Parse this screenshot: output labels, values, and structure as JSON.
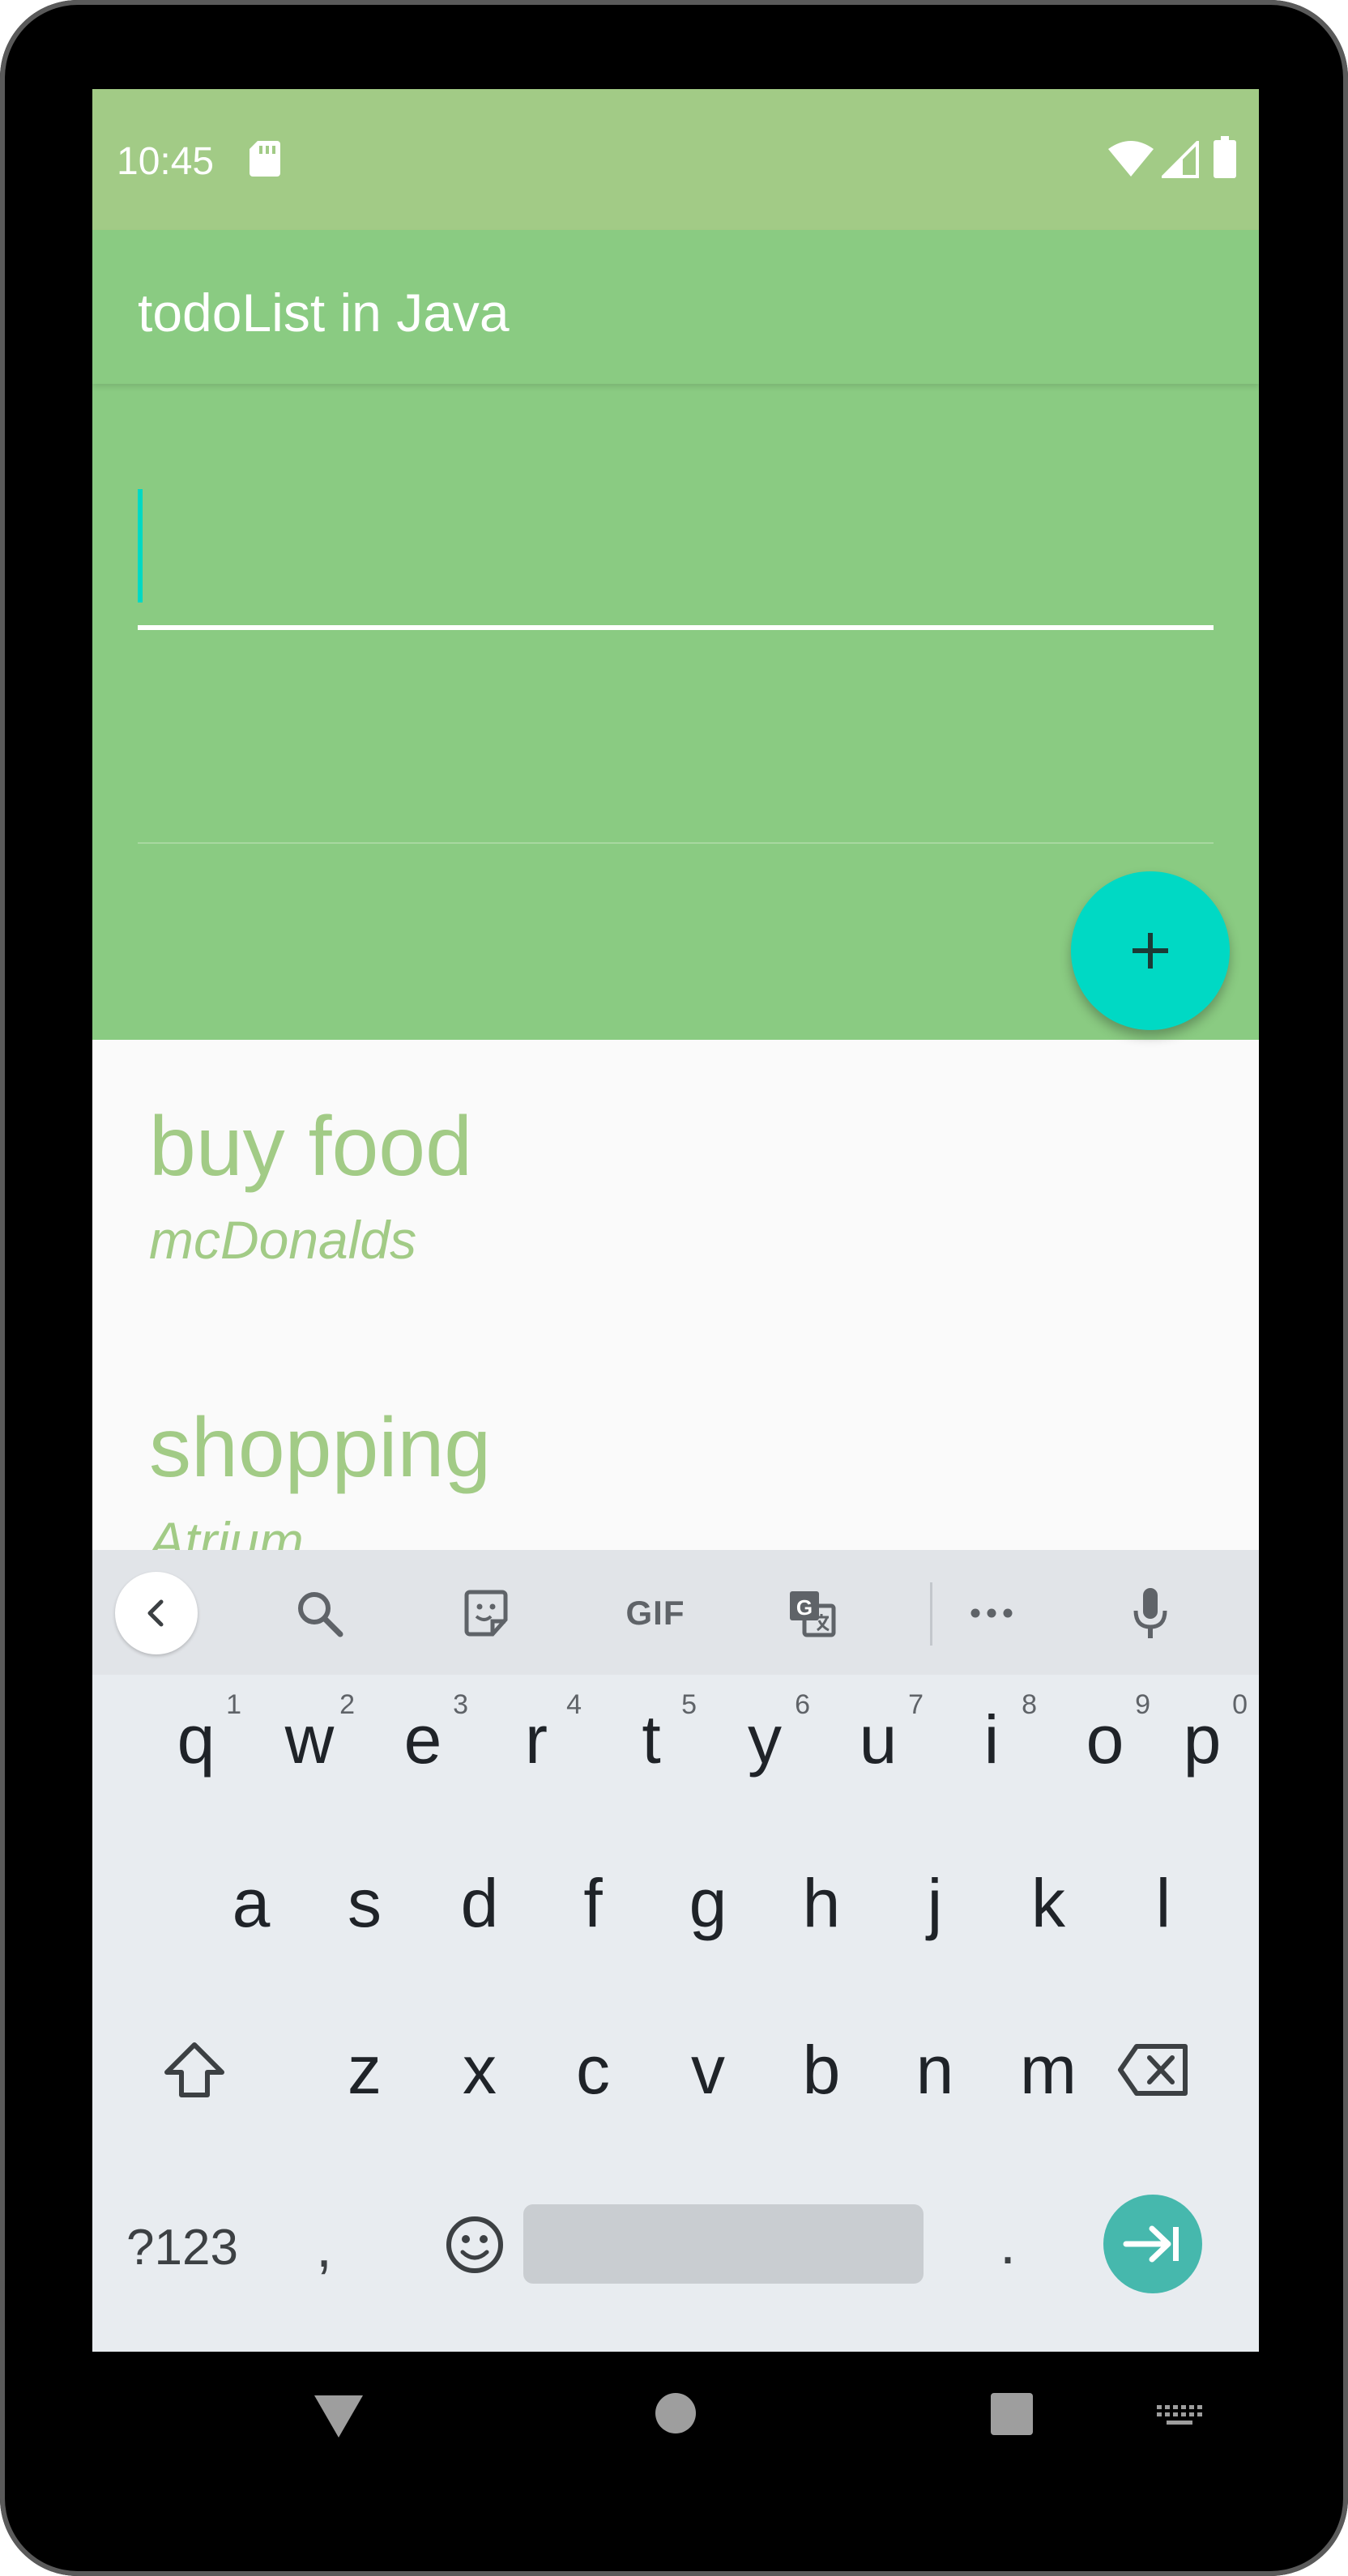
{
  "status_bar": {
    "time": "10:45"
  },
  "app_bar": {
    "title": "todoList in Java"
  },
  "input": {
    "value": "",
    "placeholder": ""
  },
  "todos": [
    {
      "title": "buy food",
      "subtitle": "mcDonalds"
    },
    {
      "title": "shopping",
      "subtitle": "Atrium"
    }
  ],
  "keyboard": {
    "toolbar": {
      "gif_label": "GIF"
    },
    "row1": [
      {
        "letter": "q",
        "hint": "1"
      },
      {
        "letter": "w",
        "hint": "2"
      },
      {
        "letter": "e",
        "hint": "3"
      },
      {
        "letter": "r",
        "hint": "4"
      },
      {
        "letter": "t",
        "hint": "5"
      },
      {
        "letter": "y",
        "hint": "6"
      },
      {
        "letter": "u",
        "hint": "7"
      },
      {
        "letter": "i",
        "hint": "8"
      },
      {
        "letter": "o",
        "hint": "9"
      },
      {
        "letter": "p",
        "hint": "0"
      }
    ],
    "row2": [
      "a",
      "s",
      "d",
      "f",
      "g",
      "h",
      "j",
      "k",
      "l"
    ],
    "row3": [
      "z",
      "x",
      "c",
      "v",
      "b",
      "n",
      "m"
    ],
    "bottom": {
      "symbols_label": "?123",
      "comma": ",",
      "period": "."
    }
  },
  "colors": {
    "status_bar": "#a2cb86",
    "app_bar": "#8acb82",
    "accent": "#00d9c4",
    "list_text": "#a2cb86",
    "enter_key": "#46b8ad"
  },
  "icons": {
    "status": [
      "sd-card-icon",
      "wifi-icon",
      "signal-icon",
      "battery-icon"
    ],
    "keyboard_toolbar": [
      "chevron-left-icon",
      "search-icon",
      "sticker-icon",
      "gif-icon",
      "translate-icon",
      "more-icon",
      "mic-icon"
    ],
    "navigation": [
      "back-triangle-icon",
      "home-circle-icon",
      "recents-square-icon",
      "keyboard-switch-icon"
    ]
  }
}
